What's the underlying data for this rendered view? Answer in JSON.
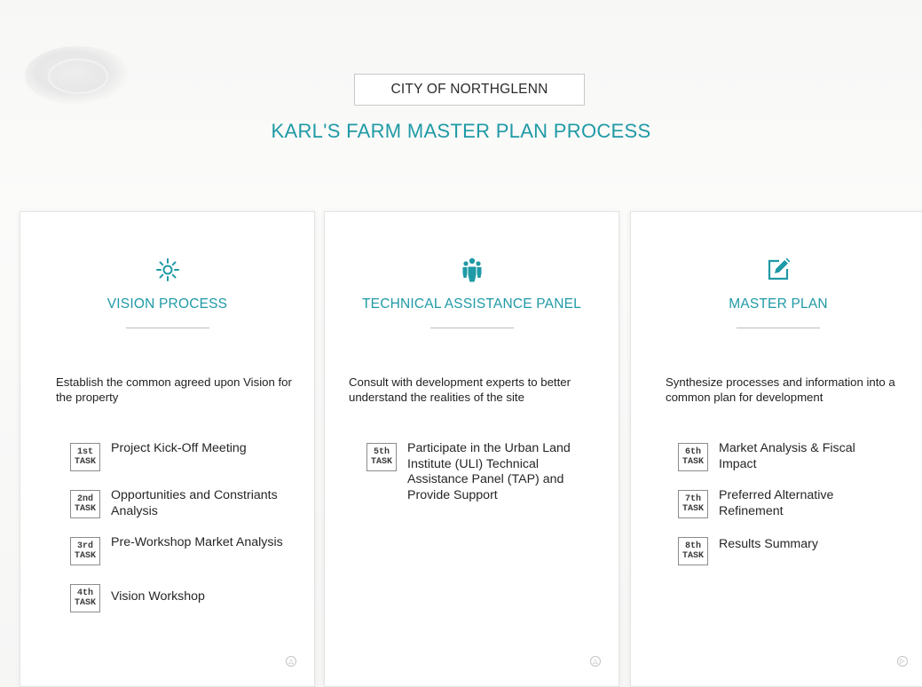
{
  "header": {
    "city": "CITY OF NORTHGLENN",
    "title": "KARL'S FARM MASTER PLAN PROCESS"
  },
  "accent_color": "#1f9aa6",
  "columns": [
    {
      "icon": "sun-icon",
      "title": "VISION PROCESS",
      "description": "Establish the common agreed upon Vision for the property",
      "tasks": [
        {
          "num": "1st",
          "label": "TASK",
          "text": "Project Kick-Off Meeting"
        },
        {
          "num": "2nd",
          "label": "TASK",
          "text": "Opportunities and Constriants Analysis"
        },
        {
          "num": "3rd",
          "label": "TASK",
          "text": "Pre-Workshop Market Analysis"
        },
        {
          "num": "4th",
          "label": "TASK",
          "text": "Vision Workshop"
        }
      ]
    },
    {
      "icon": "people-group-icon",
      "title": "TECHNICAL ASSISTANCE PANEL",
      "description": "Consult with development experts to better understand the realities of the site",
      "tasks": [
        {
          "num": "5th",
          "label": "TASK",
          "text": "Participate in the Urban Land Institute (ULI) Technical Assistance Panel (TAP) and Provide Support"
        }
      ]
    },
    {
      "icon": "edit-pencil-icon",
      "title": "MASTER PLAN",
      "description": "Synthesize processes and information into a common plan for development",
      "tasks": [
        {
          "num": "6th",
          "label": "TASK",
          "text": "Market Analysis & Fiscal Impact"
        },
        {
          "num": "7th",
          "label": "TASK",
          "text": "Preferred Alternative Refinement"
        },
        {
          "num": "8th",
          "label": "TASK",
          "text": "Results Summary"
        }
      ]
    }
  ]
}
